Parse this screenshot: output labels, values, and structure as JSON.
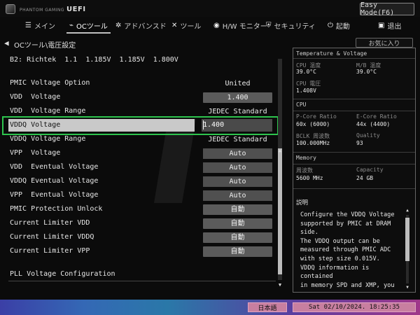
{
  "logo": {
    "small": "PHANTOM GAMING",
    "text": "UEFI"
  },
  "easy_mode": "Easy Mode(F6)",
  "nav": [
    {
      "icon": "☰",
      "label": "メイン",
      "name": "main"
    },
    {
      "icon": "⌁",
      "label": "OCツール",
      "name": "oc-tool"
    },
    {
      "icon": "✲",
      "label": "アドバンスド",
      "name": "advanced"
    },
    {
      "icon": "✕",
      "label": "ツール",
      "name": "tool"
    },
    {
      "icon": "◉",
      "label": "H/W モニター",
      "name": "hw-monitor"
    },
    {
      "icon": "⛨",
      "label": "セキュリティ",
      "name": "security"
    },
    {
      "icon": "⏻",
      "label": "起動",
      "name": "boot"
    },
    {
      "icon": "▣",
      "label": "退出",
      "name": "exit"
    }
  ],
  "active_nav": "OCツール",
  "breadcrumb": "OCツール\\電圧設定",
  "favorite": "お気に入り",
  "rows": [
    {
      "label": "B2: Richtek  1.1  1.185V  1.185V  1.800V",
      "value": "",
      "style": "none"
    },
    {
      "label": "PMIC Voltage Option",
      "value": "United",
      "style": "plain"
    },
    {
      "label": "VDD  Voltage",
      "value": "1.400",
      "style": "box"
    },
    {
      "label": "VDD  Voltage Range",
      "value": "JEDEC Standard",
      "style": "plain"
    },
    {
      "label": "VDDQ Voltage",
      "value": "1.400",
      "style": "selected"
    },
    {
      "label": "VDDQ Voltage Range",
      "value": "JEDEC Standard",
      "style": "plain"
    },
    {
      "label": "VPP  Voltage",
      "value": "Auto",
      "style": "auto"
    },
    {
      "label": "VDD  Eventual Voltage",
      "value": "Auto",
      "style": "auto"
    },
    {
      "label": "VDDQ Eventual Voltage",
      "value": "Auto",
      "style": "auto"
    },
    {
      "label": "VPP  Eventual Voltage",
      "value": "Auto",
      "style": "auto"
    },
    {
      "label": "PMIC Protection Unlock",
      "value": "自動",
      "style": "box"
    },
    {
      "label": "Current Limiter VDD",
      "value": "自動",
      "style": "box"
    },
    {
      "label": "Current Limiter VDDQ",
      "value": "自動",
      "style": "box"
    },
    {
      "label": "Current Limiter VPP",
      "value": "自動",
      "style": "box"
    },
    {
      "label": "PLL Voltage Configuration",
      "value": "",
      "style": "none"
    }
  ],
  "panel": {
    "temp_header": "Temperature & Voltage",
    "cpu_temp_k": "CPU 温度",
    "cpu_temp_v": "39.0°C",
    "mb_temp_k": "M/B 温度",
    "mb_temp_v": "39.0°C",
    "cpu_volt_k": "CPU 電圧",
    "cpu_volt_v": "1.408V",
    "cpu_header": "CPU",
    "pcore_k": "P-Core Ratio",
    "pcore_v": "60x (6000)",
    "ecore_k": "E-Core Ratio",
    "ecore_v": "44x (4400)",
    "bclk_k": "BCLK 周波数",
    "bclk_v": "100.000MHz",
    "quality_k": "Quality",
    "quality_v": "93",
    "mem_header": "Memory",
    "freq_k": "周波数",
    "freq_v": "5600 MHz",
    "cap_k": "Capacity",
    "cap_v": "24 GB",
    "desc_title": "説明",
    "desc_text": "Configure the VDDQ Voltage\nsupported by PMIC at DRAM\nside.\nThe VDDQ output can be\nmeasured through PMIC ADC\nwith step size 0.015V.\nVDDQ information is contained\nin memory SPD and XMP, you"
  },
  "footer": {
    "language": "日本語",
    "datetime": "Sat 02/10/2024. 18:25:35"
  }
}
